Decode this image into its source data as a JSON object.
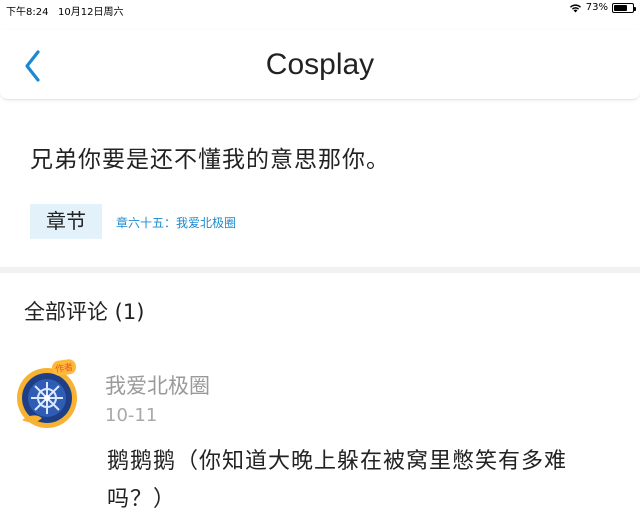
{
  "status_bar": {
    "time": "下午8:24",
    "date": "10月12日周六",
    "battery_percent": "73%",
    "battery_level": 0.73
  },
  "nav": {
    "title": "Cosplay",
    "back_icon": "chevron-left-icon"
  },
  "post": {
    "text": "兄弟你要是还不懂我的意思那你。",
    "chapter_tag": "章节",
    "chapter_link": "章六十五：我爱北极圈"
  },
  "comments": {
    "header": "全部评论 (1)",
    "items": [
      {
        "user": "我爱北极圈",
        "badge": "作者",
        "date": "10-11",
        "text": "鹅鹅鹅（你知道大晚上躲在被窝里憋笑有多难吗？）"
      }
    ]
  },
  "colors": {
    "accent": "#1b8ad0",
    "tag_bg": "#e3f1fa",
    "divider": "#f1f1f1"
  }
}
